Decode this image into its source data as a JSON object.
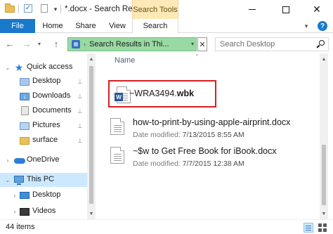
{
  "window": {
    "title": "*.docx - Search Res...",
    "contextual_tab": "Search Tools",
    "controls": {
      "minimize": "",
      "maximize": "",
      "close": "✕"
    }
  },
  "quick_access_toolbar": {
    "icons": [
      "folder-icon",
      "properties-check-icon",
      "new-file-icon",
      "customize-arrow-icon"
    ]
  },
  "ribbon": {
    "tabs": [
      {
        "label": "File",
        "active": false
      },
      {
        "label": "Home",
        "active": false
      },
      {
        "label": "Share",
        "active": false
      },
      {
        "label": "View",
        "active": false
      },
      {
        "label": "Search",
        "active": true
      }
    ],
    "collapse_icon": "chevron-down-icon",
    "help_label": "?"
  },
  "navigation": {
    "back_icon": "arrow-left-icon",
    "forward_icon": "arrow-right-icon",
    "recent_icon": "chevron-down-icon",
    "up_icon": "arrow-up-icon",
    "address": {
      "text": "Search Results in Thi...",
      "background": "#99d9a3"
    },
    "clear_label": "✕",
    "search": {
      "placeholder": "Search Desktop",
      "value": ""
    }
  },
  "nav_pane": {
    "items": [
      {
        "label": "Quick access",
        "icon": "star-icon",
        "pinned": false
      },
      {
        "label": "Desktop",
        "icon": "folder-icon",
        "pinned": true
      },
      {
        "label": "Downloads",
        "icon": "download-folder-icon",
        "pinned": true
      },
      {
        "label": "Documents",
        "icon": "documents-icon",
        "pinned": true
      },
      {
        "label": "Pictures",
        "icon": "pictures-icon",
        "pinned": true
      },
      {
        "label": "surface",
        "icon": "folder-icon",
        "pinned": true
      },
      {
        "label": "OneDrive",
        "icon": "cloud-icon",
        "pinned": false
      },
      {
        "label": "This PC",
        "icon": "computer-icon",
        "pinned": false,
        "selected": true
      },
      {
        "label": "Desktop",
        "icon": "desktop-icon",
        "pinned": false
      },
      {
        "label": "Videos",
        "icon": "video-folder-icon",
        "pinned": false
      }
    ],
    "pin_glyph": "⊥"
  },
  "content": {
    "column_header": "Name",
    "highlighted_result": {
      "name_prefix": "~WRA3494.",
      "name_ext": "wbk",
      "highlight_color": "#d81e1e"
    },
    "results": [
      {
        "name": "how-to-print-by-using-apple-airprint.docx",
        "date_label": "Date modified:",
        "date_value": "7/13/2015 8:55 AM"
      },
      {
        "name": "~$w to Get Free Book for iBook.docx",
        "date_label": "Date modified:",
        "date_value": "7/7/2015 12:38 AM"
      }
    ]
  },
  "status": {
    "item_count": "44 items",
    "view_details_icon": "details-view-icon",
    "view_tiles_icon": "large-icons-view-icon"
  },
  "colors": {
    "accent": "#1979ca",
    "selection": "#cce8ff",
    "contextual_tab": "#fde9b8"
  }
}
